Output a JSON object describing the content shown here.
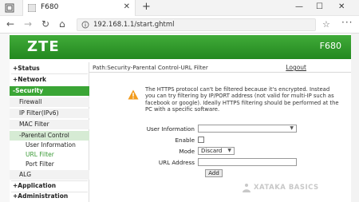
{
  "browser": {
    "tab_title": "F680",
    "new_tab": "+",
    "tab_close": "✕",
    "controls": {
      "minimize": "—",
      "maximize": "☐",
      "close": "✕"
    },
    "url": "192.168.1.1/start.ghtml",
    "nav": {
      "back": "←",
      "forward": "→",
      "refresh": "↻",
      "home": "⌂",
      "star": "☆",
      "menu": "···"
    }
  },
  "router": {
    "logo": "ZTE",
    "model": "F680"
  },
  "sidebar": {
    "items": [
      {
        "label": "+Status"
      },
      {
        "label": "+Network"
      },
      {
        "label": "-Security"
      },
      {
        "label": "Firewall"
      },
      {
        "label": "IP Filter(IPv6)"
      },
      {
        "label": "MAC Filter"
      },
      {
        "label": "-Parental Control"
      },
      {
        "label": "User Information"
      },
      {
        "label": "URL Filter"
      },
      {
        "label": "Port Filter"
      },
      {
        "label": "ALG"
      },
      {
        "label": "+Application"
      },
      {
        "label": "+Administration"
      }
    ]
  },
  "main": {
    "path": "Path:Security-Parental Control-URL Filter",
    "logout": "Logout",
    "warning": "The HTTPS protocol can't be filtered because it's encrypted. Instead you can try filtering by IP/PORT address (not valid for multi-IP such as facebook or google). Ideally HTTPS filtering should be performed at the PC with a specific software.",
    "form": {
      "user_information_label": "User Information",
      "user_information_value": "",
      "enable_label": "Enable",
      "mode_label": "Mode",
      "mode_value": "Discard",
      "url_address_label": "URL Address",
      "url_address_value": "",
      "add_label": "Add"
    }
  },
  "watermark": "XATAKA BASICS",
  "colors": {
    "brand_green": "#2e9a2a",
    "active_green": "#3aa535"
  }
}
